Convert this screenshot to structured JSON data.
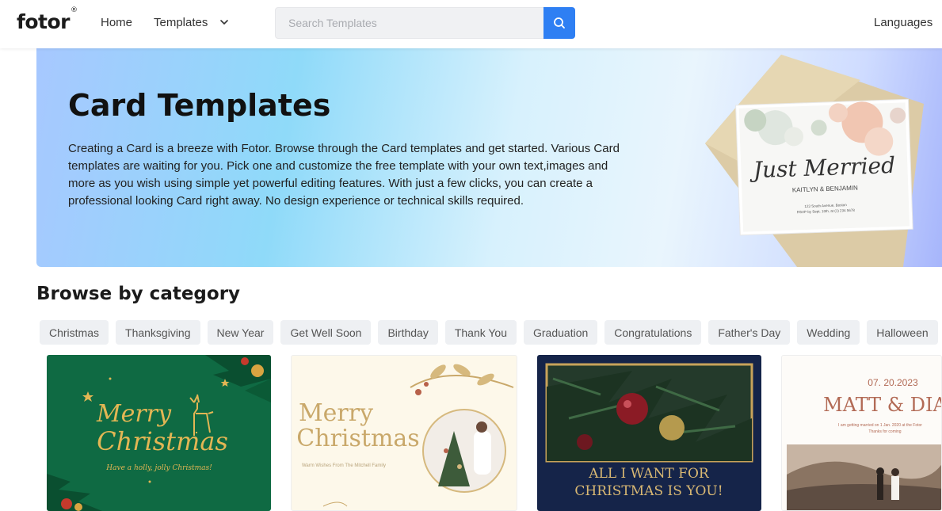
{
  "header": {
    "logo": "fotor",
    "logo_mark": "®",
    "nav": {
      "home": "Home",
      "templates": "Templates",
      "languages": "Languages"
    },
    "search": {
      "placeholder": "Search Templates",
      "value": ""
    }
  },
  "hero": {
    "title": "Card Templates",
    "description": "Creating a Card is a breeze with Fotor. Browse through the Card templates and get started. Various Card templates are waiting for you. Pick one and customize the free template with your own text,images and more as you wish using simple yet powerful editing features. With just a few clicks, you can create a professional looking Card right away. No design experience or technical skills required.",
    "preview_card": {
      "script": "Just Merried",
      "names": "KAITLYN & BENJAMIN",
      "line1": "123 South Avenue, Boston",
      "line2": "RSVP by Sept. 10th, at (1) 234 5678"
    }
  },
  "browse": {
    "title": "Browse by category",
    "categories": [
      "Christmas",
      "Thanksgiving",
      "New Year",
      "Get Well Soon",
      "Birthday",
      "Thank You",
      "Graduation",
      "Congratulations",
      "Father's Day",
      "Wedding",
      "Halloween"
    ]
  },
  "cards": [
    {
      "line1": "Merry",
      "line2": "Christmas",
      "sub": "Have a holly, jolly Christmas!"
    },
    {
      "line1": "Merry",
      "line2": "Christmas",
      "sub": "Warm Wishes From The Mitchell Family"
    },
    {
      "line1": "ALL I WANT FOR",
      "line2": "CHRISTMAS IS YOU!"
    },
    {
      "date": "07. 20.2023",
      "names": "MATT & DIA",
      "sub1": "I am getting married on 1 Jan. 2020 at the Fotor",
      "sub2": "Thanks for coming"
    }
  ],
  "colors": {
    "accent": "#2e7ff3",
    "chip_bg": "#eef0f3"
  },
  "icons": {
    "search": "search-icon",
    "chevron": "chevron-down-icon"
  }
}
